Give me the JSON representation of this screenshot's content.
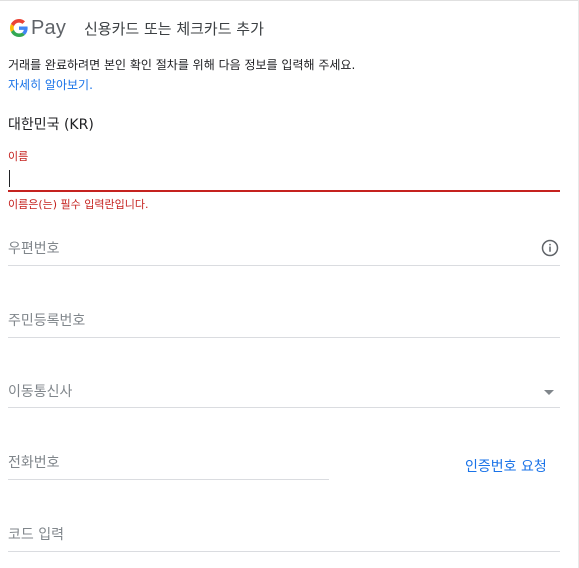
{
  "header": {
    "logo_text": "Pay",
    "title": "신용카드 또는 체크카드 추가"
  },
  "notice": {
    "text": "거래를 완료하려면 본인 확인 절차를 위해 다음 정보를 입력해 주세요.",
    "link_label": "자세히 알아보기."
  },
  "country": "대한민국 (KR)",
  "form": {
    "name": {
      "label": "이름",
      "value": "",
      "error": "이름은(는) 필수 입력란입니다."
    },
    "postal_code": {
      "placeholder": "우편번호",
      "icon": "info-icon"
    },
    "rrn": {
      "placeholder": "주민등록번호"
    },
    "carrier": {
      "placeholder": "이동통신사",
      "icon": "dropdown-arrow"
    },
    "phone": {
      "placeholder": "전화번호"
    },
    "request_code_label": "인증번호 요청",
    "verification_code": {
      "placeholder": "코드 입력"
    }
  },
  "colors": {
    "error": "#c5221f",
    "link": "#1a73e8",
    "underline": "#dadce0",
    "placeholder": "#80868b"
  }
}
